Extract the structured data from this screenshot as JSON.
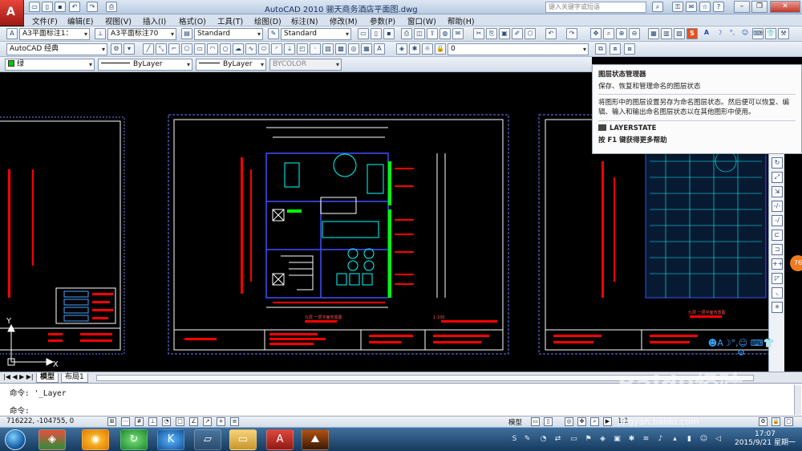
{
  "window": {
    "title": "AutoCAD 2010     骊天商务酒店平面图.dwg",
    "help_placeholder": "键入关键字或短语"
  },
  "menu": [
    {
      "label": "文件(F)"
    },
    {
      "label": "编辑(E)"
    },
    {
      "label": "视图(V)"
    },
    {
      "label": "插入(I)"
    },
    {
      "label": "格式(O)"
    },
    {
      "label": "工具(T)"
    },
    {
      "label": "绘图(D)"
    },
    {
      "label": "标注(N)"
    },
    {
      "label": "修改(M)"
    },
    {
      "label": "参数(P)"
    },
    {
      "label": "窗口(W)"
    },
    {
      "label": "帮助(H)"
    }
  ],
  "toolbar1": {
    "dim_style_1": "A3平面标注1：",
    "dim_style_2": "A3平面标注70",
    "text_style": "Standard",
    "table_style": "Standard"
  },
  "toolbar2": {
    "workspace": "AutoCAD 经典",
    "layer_value": "0"
  },
  "toolbar3": {
    "color": "绿",
    "linetype": "ByLayer",
    "lineweight": "ByLayer",
    "plotstyle": "BYCOLOR"
  },
  "tooltip": {
    "title": "图层状态管理器",
    "subtitle": "保存、恢复和管理命名的图层状态",
    "description": "将图形中的图层设置另存为命名图层状态。然后便可以恢复、编辑、输入和输出命名图层状态以在其他图形中使用。",
    "command": "LAYERSTATE",
    "help_hint": "按 F1 键获得更多帮助"
  },
  "tabs": [
    {
      "label": "模型"
    },
    {
      "label": "布局1"
    }
  ],
  "command_history": [
    "命令: '_Layer",
    "命令:"
  ],
  "status": {
    "coords": "716222, -104755, 0",
    "mode": "模型",
    "scale": "1:1"
  },
  "taskbar": {
    "time": "17:07",
    "date": "2015/9/21 星期一",
    "badge": "76"
  },
  "drawing": {
    "left_sheet_title": "",
    "center_plan_label": "九层 一层平面布置图",
    "center_scale_label": "1:100",
    "right_plan_label": "九层 一层平面布置图"
  },
  "ui_mark": {
    "watermark": "Baidu经验",
    "watermark_url": "jingyan.baidu.com",
    "ime_logo": "S"
  },
  "colors": {
    "background": "#000000",
    "frame": "#ffffff",
    "dim_red": "#ff0000",
    "cyan": "#00ffff",
    "green": "#00ff00",
    "border_blue": "#4060ff"
  }
}
